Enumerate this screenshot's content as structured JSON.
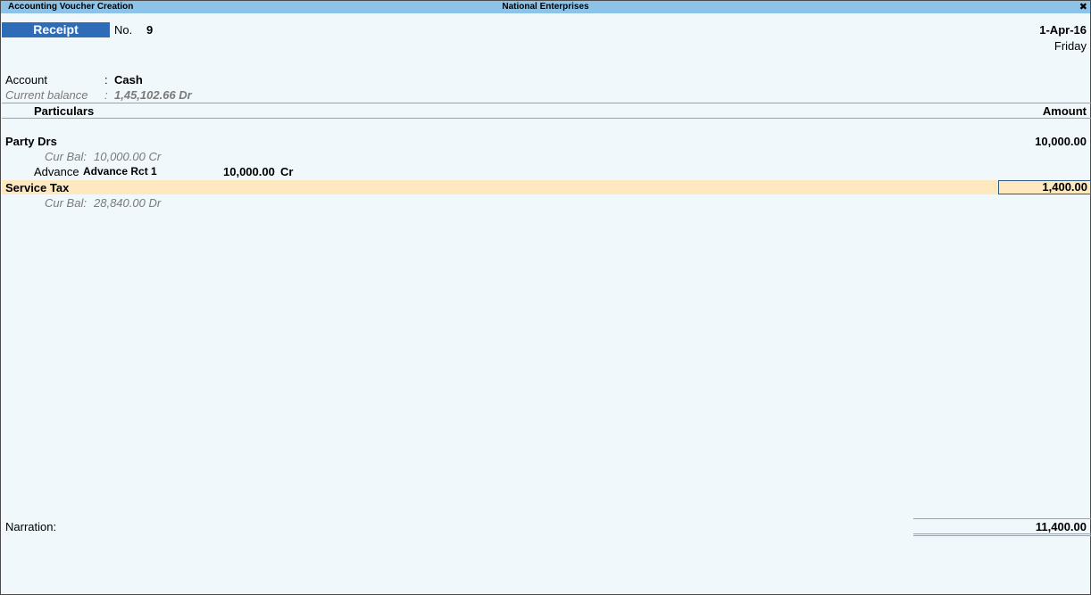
{
  "window": {
    "title": "Accounting Voucher Creation",
    "company": "National Enterprises",
    "close_glyph": "✖"
  },
  "voucher": {
    "type": "Receipt",
    "no_label": "No.",
    "number": "9",
    "date": "1-Apr-16",
    "day": "Friday"
  },
  "account": {
    "label": "Account",
    "sep": ":",
    "value": "Cash",
    "balance_label": "Current balance",
    "balance_value": "1,45,102.66 Dr"
  },
  "columns": {
    "particulars": "Particulars",
    "amount": "Amount"
  },
  "entries": [
    {
      "name": "Party Drs",
      "amount": "10,000.00",
      "cur_bal_label": "Cur Bal:",
      "cur_bal": "10,000.00 Cr",
      "bill": {
        "type": "Advance",
        "name": "Advance Rct 1",
        "amount": "10,000.00",
        "drcr": "Cr"
      }
    },
    {
      "name": "Service Tax",
      "amount": "1,400.00",
      "cur_bal_label": "Cur Bal:",
      "cur_bal": "28,840.00 Dr"
    }
  ],
  "narration": {
    "label": "Narration:",
    "total": "11,400.00"
  }
}
